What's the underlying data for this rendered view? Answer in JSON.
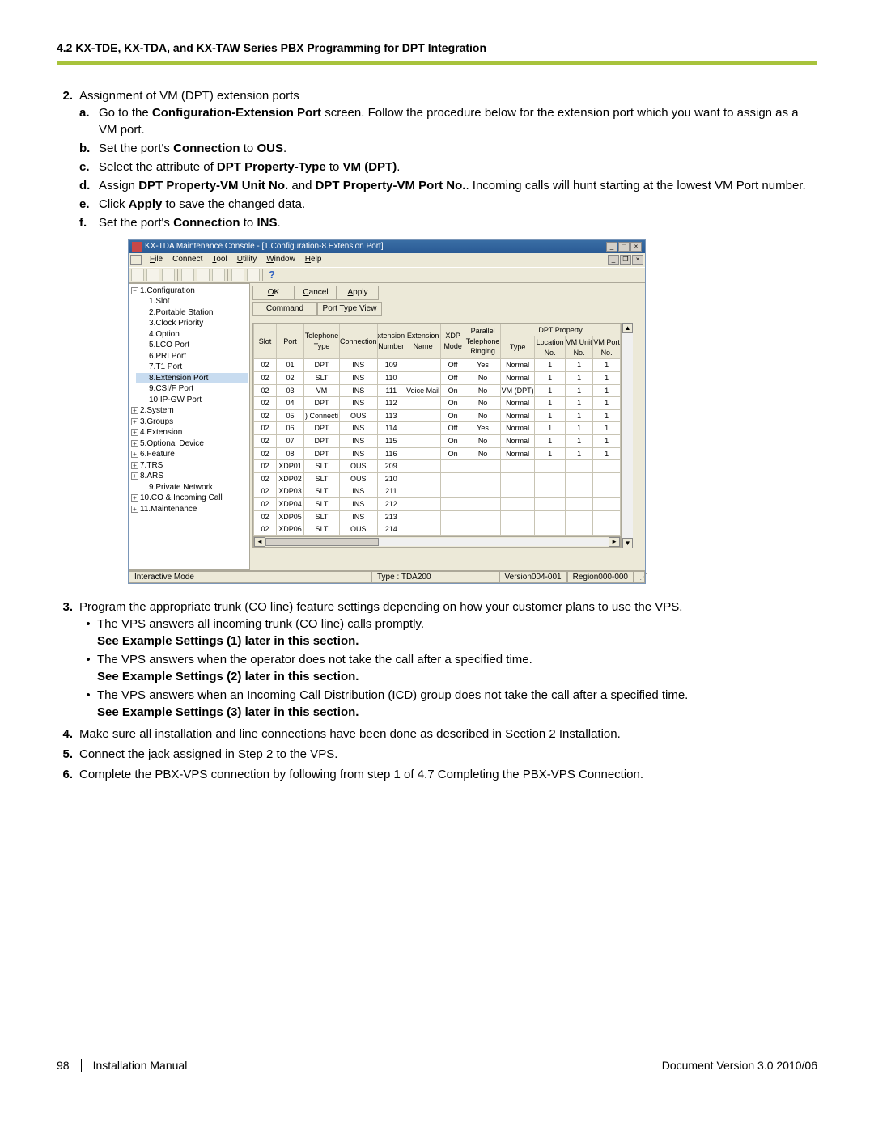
{
  "header": "4.2 KX-TDE, KX-TDA, and KX-TAW Series PBX Programming for DPT Integration",
  "steps": {
    "s2": {
      "num": "2.",
      "title": "Assignment of VM (DPT) extension ports",
      "a": {
        "num": "a.",
        "pre": "Go to the ",
        "bold": "Configuration-Extension Port",
        "post": " screen. Follow the procedure below for the extension port which you want to assign as a VM port."
      },
      "b": {
        "num": "b.",
        "pre": "Set the port's ",
        "b1": "Connection",
        "mid": " to ",
        "b2": "OUS",
        "post": "."
      },
      "c": {
        "num": "c.",
        "pre": "Select the attribute of ",
        "b1": "DPT Property-Type",
        "mid": " to ",
        "b2": "VM (DPT)",
        "post": "."
      },
      "d": {
        "num": "d.",
        "pre": "Assign ",
        "b1": "DPT Property-VM Unit No.",
        "mid": " and ",
        "b2": "DPT Property-VM Port No.",
        "post": ". Incoming calls will hunt starting at the lowest VM Port number."
      },
      "e": {
        "num": "e.",
        "pre": "Click ",
        "b1": "Apply",
        "post": " to save the changed data."
      },
      "f": {
        "num": "f.",
        "pre": "Set the port's ",
        "b1": "Connection",
        "mid": " to ",
        "b2": "INS",
        "post": "."
      }
    },
    "s3": {
      "num": "3.",
      "text": "Program the appropriate trunk (CO line) feature settings depending on how your customer plans to use the VPS.",
      "b1": {
        "t": "The VPS answers all incoming trunk (CO line) calls promptly.",
        "see": "See Example Settings (1) later in this section."
      },
      "b2": {
        "t": "The VPS answers when the operator does not take the call after a specified time.",
        "see": "See Example Settings (2) later in this section."
      },
      "b3": {
        "t": "The VPS answers when an Incoming Call Distribution (ICD) group does not take the call after a specified time.",
        "see": "See Example Settings (3) later in this section."
      }
    },
    "s4": {
      "num": "4.",
      "text": "Make sure all installation and line connections have been done as described in Section  2  Installation."
    },
    "s5": {
      "num": "5.",
      "text": "Connect the jack assigned in Step 2 to the VPS."
    },
    "s6": {
      "num": "6.",
      "text": "Complete the PBX-VPS connection by following from step 1 of 4.7  Completing the PBX-VPS Connection."
    }
  },
  "window": {
    "title": "KX-TDA Maintenance Console - [1.Configuration-8.Extension Port]",
    "menu": {
      "file": "File",
      "connect": "Connect",
      "tool": "Tool",
      "utility": "Utility",
      "window": "Window",
      "help": "Help"
    },
    "buttons": {
      "ok": "OK",
      "cancel": "Cancel",
      "apply": "Apply",
      "command": "Command",
      "ptv": "Port Type View"
    },
    "tree": {
      "n1": "1.Configuration",
      "c1": "1.Slot",
      "c2": "2.Portable Station",
      "c3": "3.Clock Priority",
      "c4": "4.Option",
      "c5": "5.LCO Port",
      "c6": "6.PRI Port",
      "c7": "7.T1 Port",
      "c8": "8.Extension Port",
      "c9": "9.CSI/F Port",
      "c10": "10.IP-GW Port",
      "n2": "2.System",
      "n3": "3.Groups",
      "n4": "4.Extension",
      "n5": "5.Optional Device",
      "n6": "6.Feature",
      "n7": "7.TRS",
      "n8": "8.ARS",
      "n9": "9.Private Network",
      "n10": "10.CO & Incoming Call",
      "n11": "11.Maintenance"
    },
    "cols": {
      "slot": "Slot",
      "port": "Port",
      "teltype": "Telephone Type",
      "conn": "Connection",
      "xno": "xtension Number",
      "xname": "Extension Name",
      "xdp": "XDP Mode",
      "ptr": "Parallel Telephone Ringing",
      "dpt": "DPT Property",
      "type": "Type",
      "loc": "Location No.",
      "vmu": "VM Unit No.",
      "vmp": "VM Port No."
    },
    "rows": [
      {
        "slot": "02",
        "port": "01",
        "tt": "DPT",
        "conn": "INS",
        "xn": "109",
        "xname": "",
        "xdp": "Off",
        "ptr": "Yes",
        "type": "Normal",
        "loc": "1",
        "vmu": "1",
        "vmp": "1"
      },
      {
        "slot": "02",
        "port": "02",
        "tt": "SLT",
        "conn": "INS",
        "xn": "110",
        "xname": "",
        "xdp": "Off",
        "ptr": "No",
        "type": "Normal",
        "loc": "1",
        "vmu": "1",
        "vmp": "1"
      },
      {
        "slot": "02",
        "port": "03",
        "tt": "VM",
        "conn": "INS",
        "xn": "111",
        "xname": "Voice Mail",
        "xdp": "On",
        "ptr": "No",
        "type": "VM (DPT)",
        "loc": "1",
        "vmu": "1",
        "vmp": "1"
      },
      {
        "slot": "02",
        "port": "04",
        "tt": "DPT",
        "conn": "INS",
        "xn": "112",
        "xname": "",
        "xdp": "On",
        "ptr": "No",
        "type": "Normal",
        "loc": "1",
        "vmu": "1",
        "vmp": "1"
      },
      {
        "slot": "02",
        "port": "05",
        "tt": ") Connecti",
        "conn": "OUS",
        "xn": "113",
        "xname": "",
        "xdp": "On",
        "ptr": "No",
        "type": "Normal",
        "loc": "1",
        "vmu": "1",
        "vmp": "1"
      },
      {
        "slot": "02",
        "port": "06",
        "tt": "DPT",
        "conn": "INS",
        "xn": "114",
        "xname": "",
        "xdp": "Off",
        "ptr": "Yes",
        "type": "Normal",
        "loc": "1",
        "vmu": "1",
        "vmp": "1"
      },
      {
        "slot": "02",
        "port": "07",
        "tt": "DPT",
        "conn": "INS",
        "xn": "115",
        "xname": "",
        "xdp": "On",
        "ptr": "No",
        "type": "Normal",
        "loc": "1",
        "vmu": "1",
        "vmp": "1"
      },
      {
        "slot": "02",
        "port": "08",
        "tt": "DPT",
        "conn": "INS",
        "xn": "116",
        "xname": "",
        "xdp": "On",
        "ptr": "No",
        "type": "Normal",
        "loc": "1",
        "vmu": "1",
        "vmp": "1"
      },
      {
        "slot": "02",
        "port": "XDP01",
        "tt": "SLT",
        "conn": "OUS",
        "xn": "209",
        "xname": "",
        "xdp": "",
        "ptr": "",
        "type": "",
        "loc": "",
        "vmu": "",
        "vmp": ""
      },
      {
        "slot": "02",
        "port": "XDP02",
        "tt": "SLT",
        "conn": "OUS",
        "xn": "210",
        "xname": "",
        "xdp": "",
        "ptr": "",
        "type": "",
        "loc": "",
        "vmu": "",
        "vmp": ""
      },
      {
        "slot": "02",
        "port": "XDP03",
        "tt": "SLT",
        "conn": "INS",
        "xn": "211",
        "xname": "",
        "xdp": "",
        "ptr": "",
        "type": "",
        "loc": "",
        "vmu": "",
        "vmp": ""
      },
      {
        "slot": "02",
        "port": "XDP04",
        "tt": "SLT",
        "conn": "INS",
        "xn": "212",
        "xname": "",
        "xdp": "",
        "ptr": "",
        "type": "",
        "loc": "",
        "vmu": "",
        "vmp": ""
      },
      {
        "slot": "02",
        "port": "XDP05",
        "tt": "SLT",
        "conn": "INS",
        "xn": "213",
        "xname": "",
        "xdp": "",
        "ptr": "",
        "type": "",
        "loc": "",
        "vmu": "",
        "vmp": ""
      },
      {
        "slot": "02",
        "port": "XDP06",
        "tt": "SLT",
        "conn": "OUS",
        "xn": "214",
        "xname": "",
        "xdp": "",
        "ptr": "",
        "type": "",
        "loc": "",
        "vmu": "",
        "vmp": ""
      }
    ],
    "status": {
      "mode": "Interactive Mode",
      "type": "Type : TDA200",
      "ver": "Version004-001",
      "reg": "Region000-000"
    }
  },
  "footer": {
    "page": "98",
    "manual": "Installation Manual",
    "ver": "Document Version  3.0  2010/06"
  }
}
